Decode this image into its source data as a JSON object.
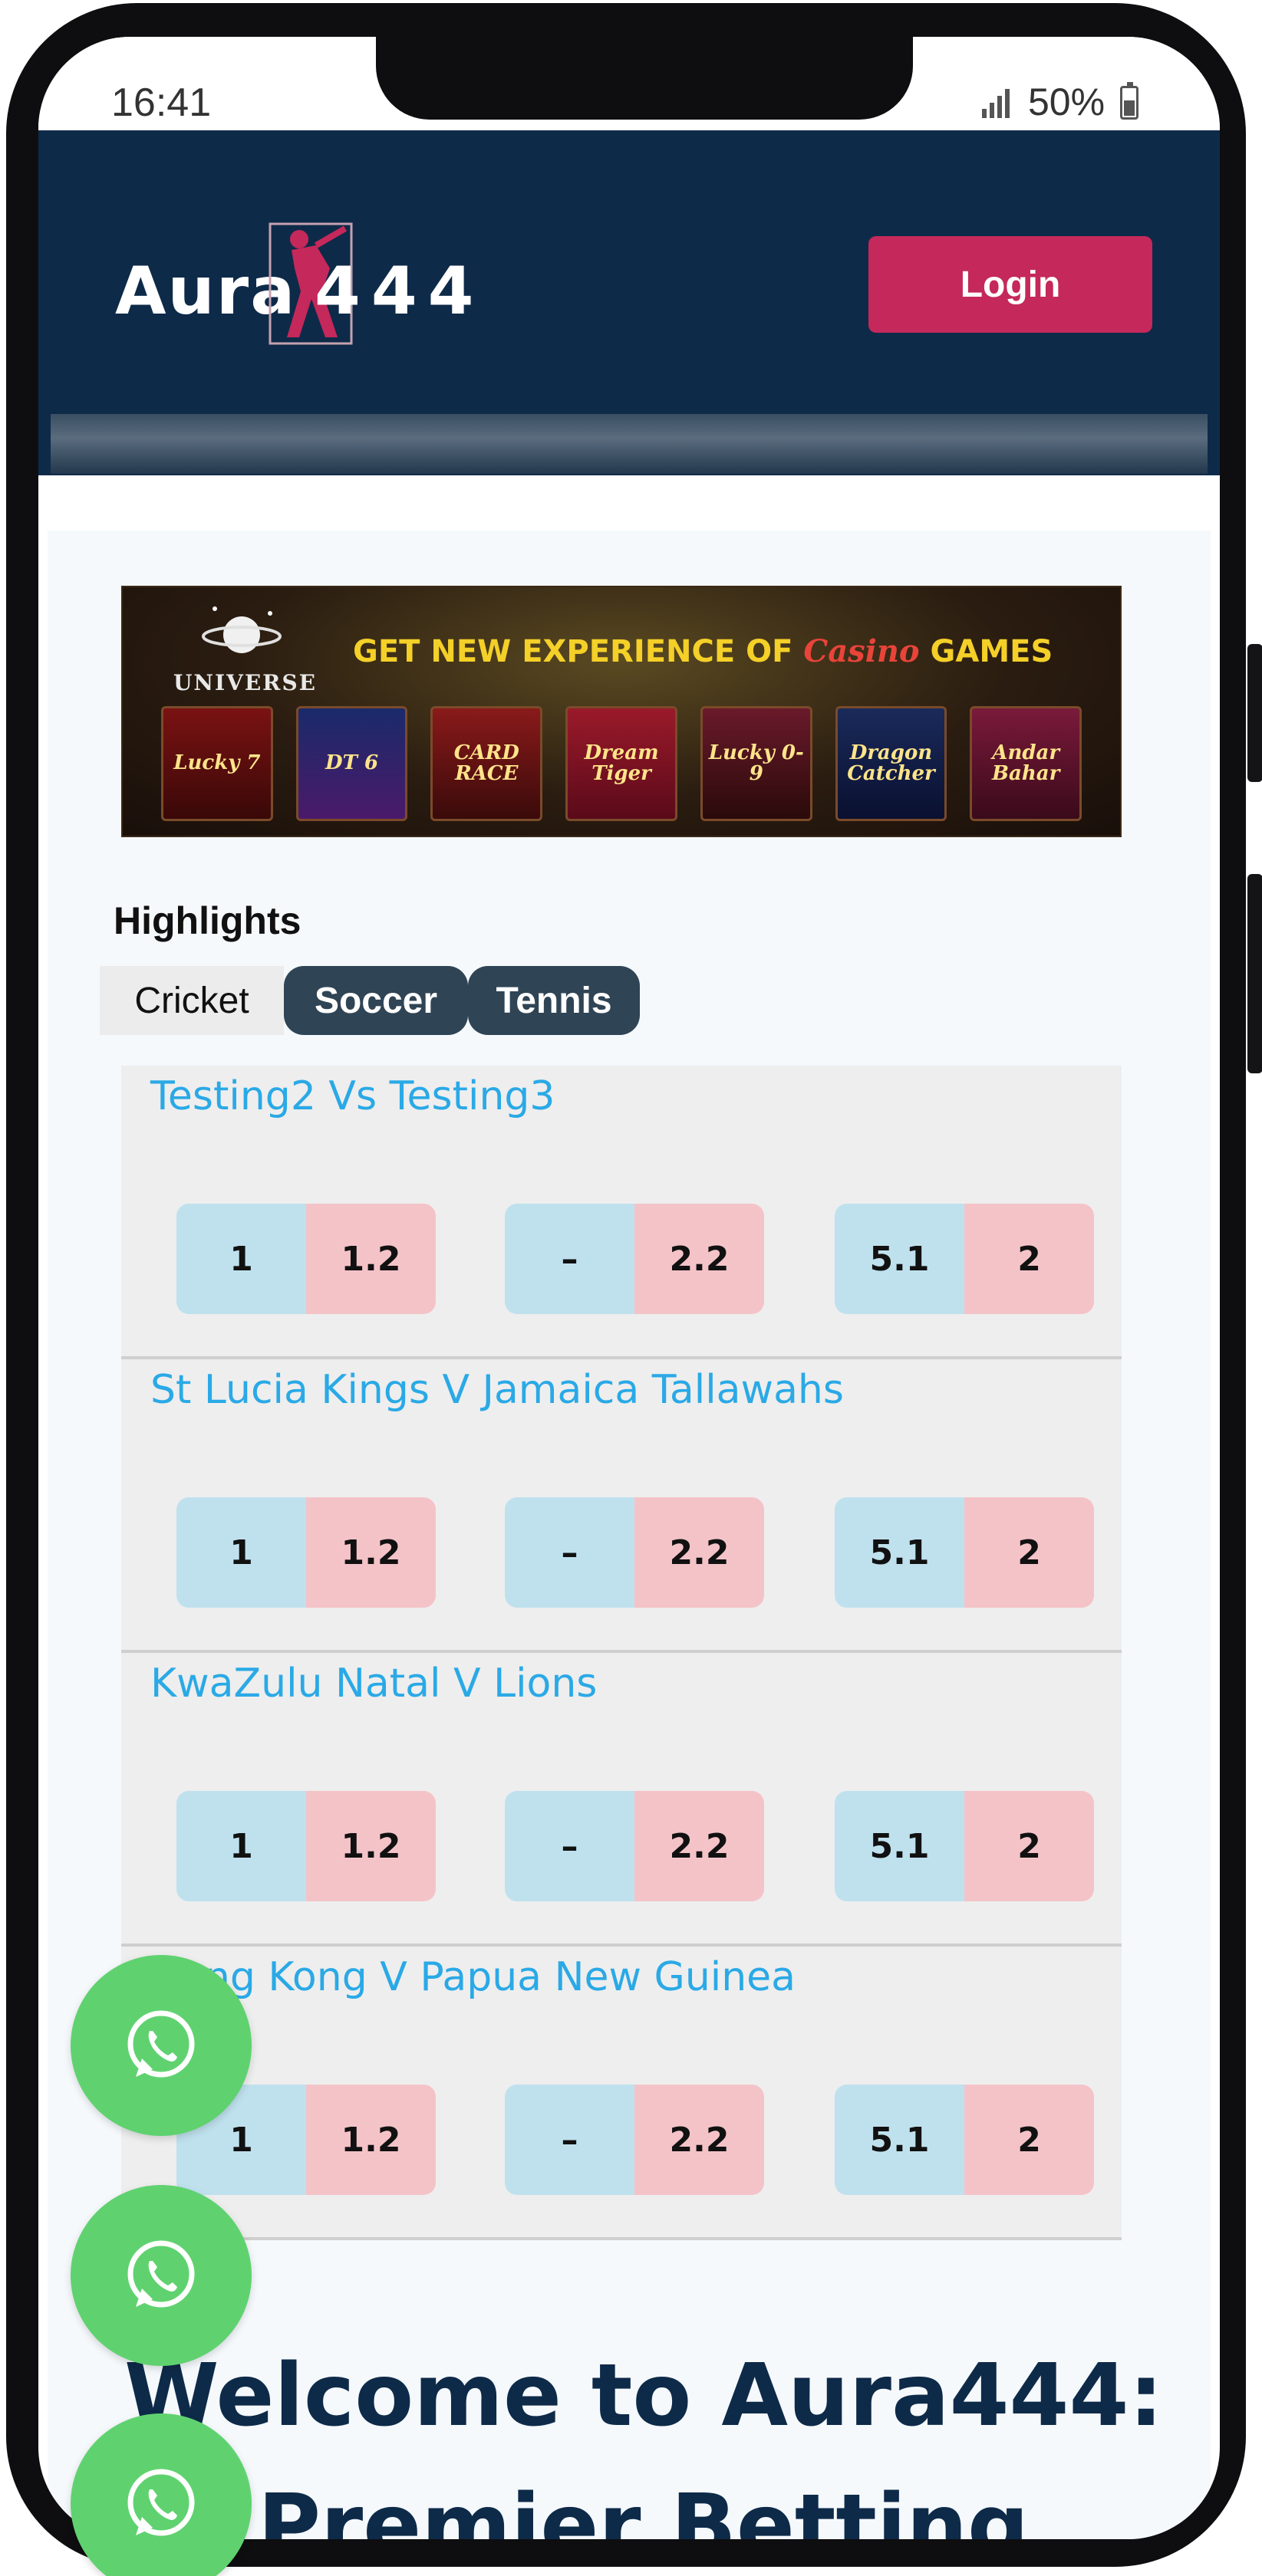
{
  "status_bar": {
    "time": "16:41",
    "battery": "50%"
  },
  "header": {
    "logo_text": "Aura",
    "logo_number": "444",
    "login_label": "Login"
  },
  "banner": {
    "brand": "UNIVERSE",
    "headline_start": "GET NEW EXPERIENCE OF ",
    "headline_casino": "Casino",
    "headline_end": " GAMES",
    "tiles": [
      "Lucky 7",
      "DT 6",
      "CARD RACE",
      "Dream Tiger",
      "Lucky 0-9",
      "Dragon Catcher",
      "Andar Bahar"
    ]
  },
  "highlights": {
    "title": "Highlights",
    "tabs": [
      "Cricket",
      "Soccer",
      "Tennis"
    ]
  },
  "matches": [
    {
      "title": "Testing2 Vs Testing3",
      "odds": [
        [
          "1",
          "1.2"
        ],
        [
          "–",
          "2.2"
        ],
        [
          "5.1",
          "2"
        ]
      ]
    },
    {
      "title": "St Lucia Kings V Jamaica Tallawahs",
      "odds": [
        [
          "1",
          "1.2"
        ],
        [
          "–",
          "2.2"
        ],
        [
          "5.1",
          "2"
        ]
      ]
    },
    {
      "title": "KwaZulu Natal V Lions",
      "odds": [
        [
          "1",
          "1.2"
        ],
        [
          "–",
          "2.2"
        ],
        [
          "5.1",
          "2"
        ]
      ]
    },
    {
      "title": "Hong Kong V Papua New Guinea",
      "odds": [
        [
          "1",
          "1.2"
        ],
        [
          "–",
          "2.2"
        ],
        [
          "5.1",
          "2"
        ]
      ]
    }
  ],
  "welcome": {
    "line1": "Welcome to Aura444:",
    "line2": "ur Premier Betting"
  },
  "colors": {
    "header_bg": "#0e2a49",
    "login_bg": "#c5285a",
    "match_title": "#2aa9e6",
    "back_odd": "#bfe1ee",
    "lay_odd": "#f4c3c8",
    "whatsapp": "#5fd26f"
  }
}
